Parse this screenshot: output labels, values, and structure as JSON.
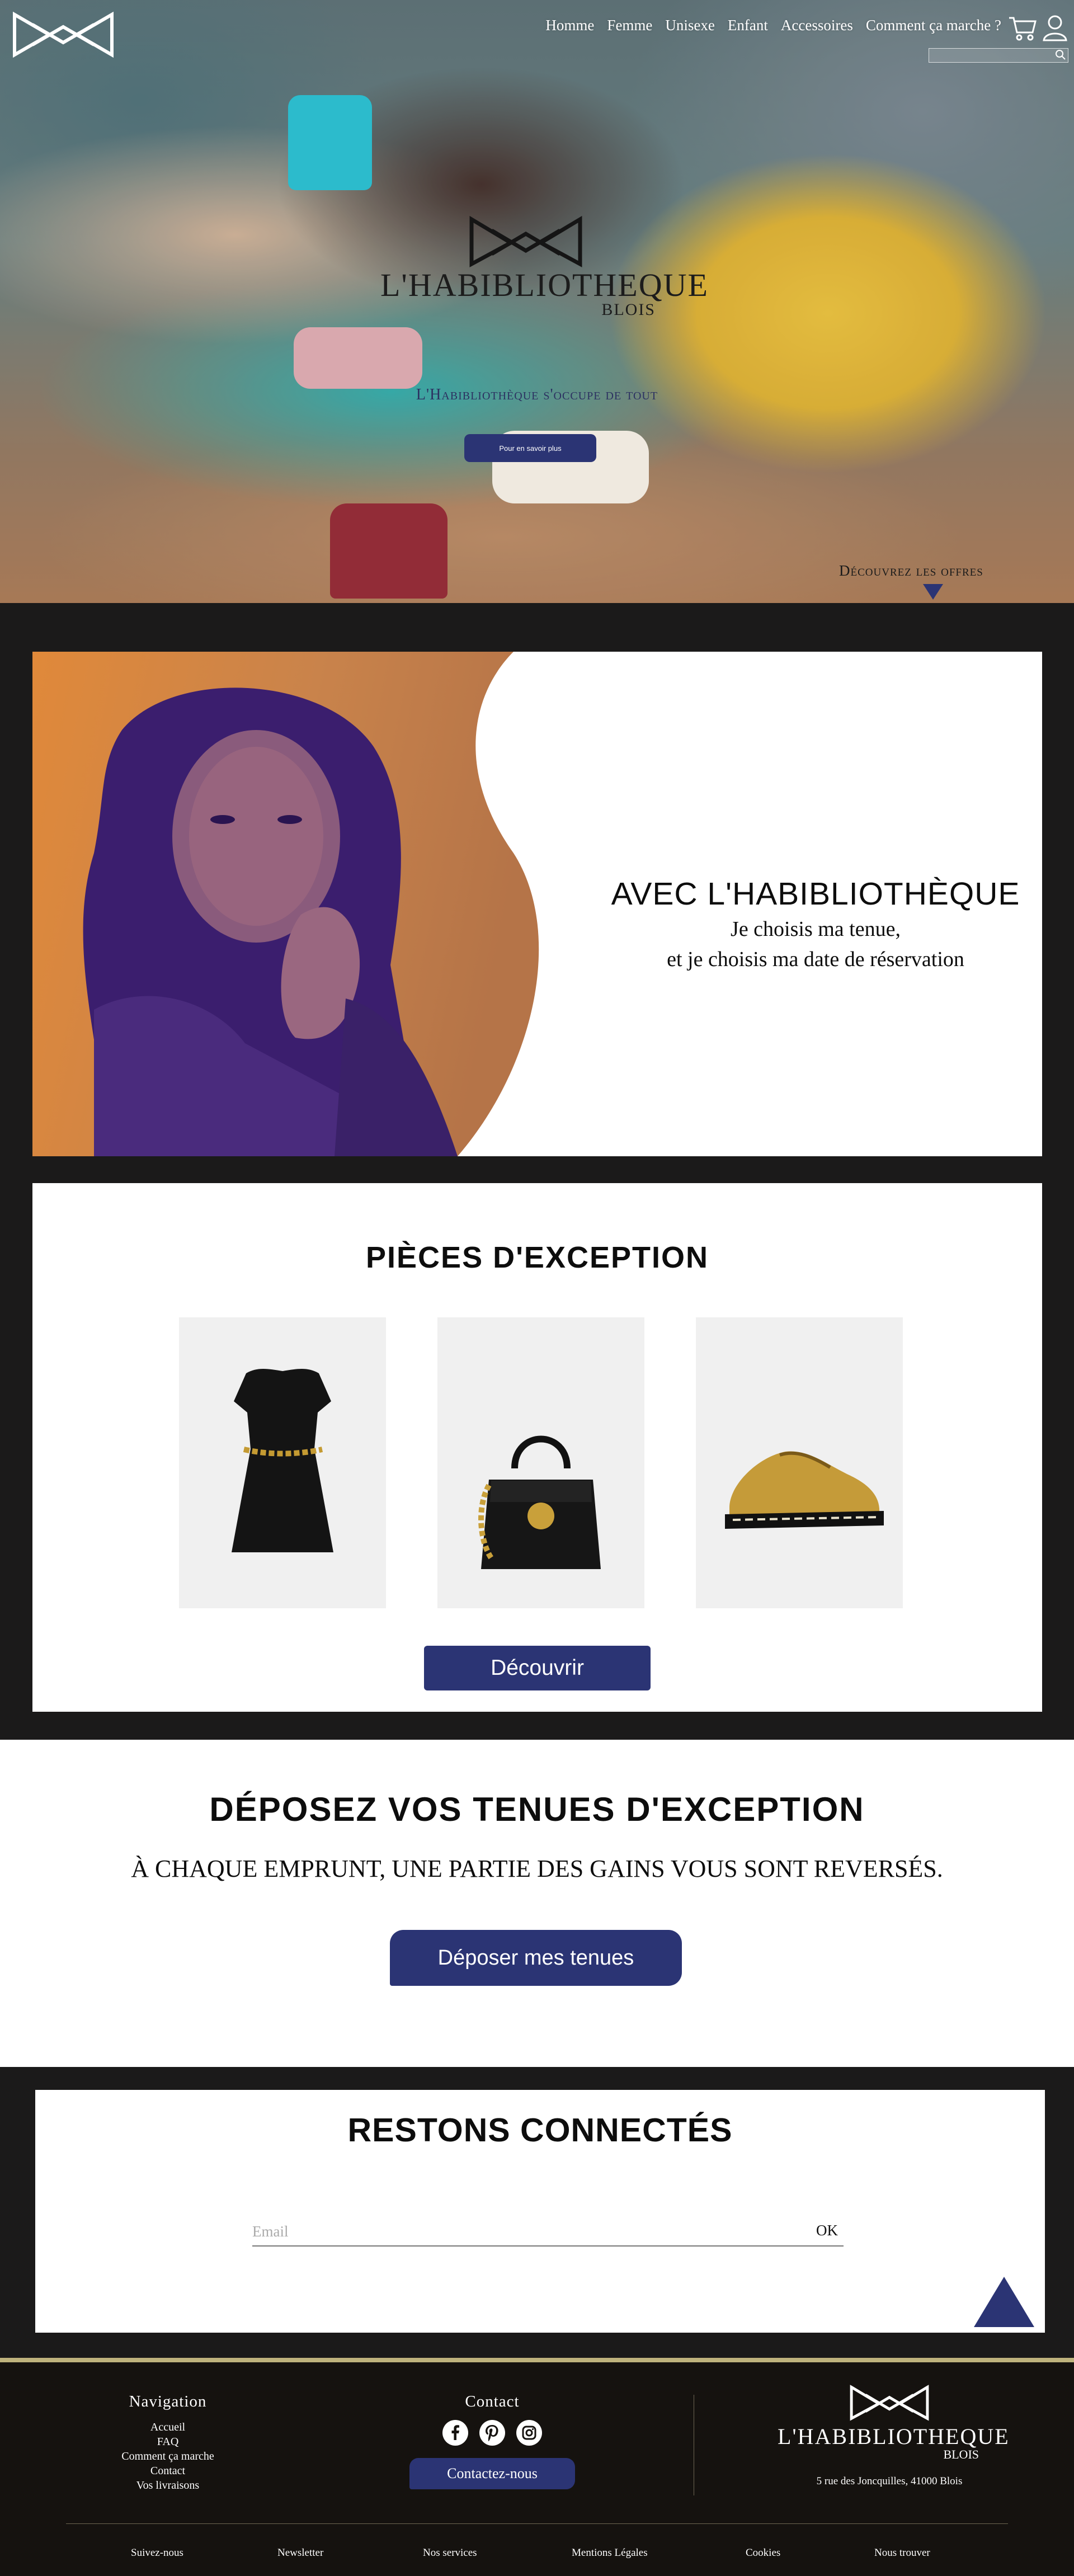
{
  "header": {
    "nav": [
      "Homme",
      "Femme",
      "Unisexe",
      "Enfant",
      "Accessoires",
      "Comment ça marche ?"
    ],
    "search_placeholder": ""
  },
  "hero": {
    "brand_name": "L'HABIBLIOTHEQUE",
    "brand_city": "BLOIS",
    "tagline": "L'Habibliothèque s'occupe de tout",
    "button_label": "Pour en savoir plus",
    "offers_link": "Découvrez les offres"
  },
  "avec": {
    "title": "AVEC L'HABIBLIOTHÈQUE",
    "line1": "Je choisis ma tenue,",
    "line2": "et je choisis ma date de réservation"
  },
  "pieces": {
    "title": "PIÈCES D'EXCEPTION",
    "button_label": "Découvrir"
  },
  "deposez": {
    "title": "DÉPOSEZ VOS TENUES D'EXCEPTION",
    "subtitle": "À CHAQUE EMPRUNT, UNE PARTIE DES GAINS VOUS SONT REVERSÉS.",
    "button_label": "Déposer mes tenues"
  },
  "connect": {
    "title": "RESTONS CONNECTÉS",
    "email_placeholder": "Email",
    "ok_label": "OK"
  },
  "footer": {
    "nav_title": "Navigation",
    "nav_links": [
      "Accueil",
      "FAQ",
      "Comment ça marche",
      "Contact",
      "Vos livraisons"
    ],
    "contact_title": "Contact",
    "contact_button": "Contactez-nous",
    "brand_name": "L'HABIBLIOTHEQUE",
    "brand_city": "BLOIS",
    "address": "5 rue des Joncquilles, 41000 Blois",
    "bottom_links": [
      "Suivez-nous",
      "Newsletter",
      "Nos services",
      "Mentions Légales",
      "Cookies",
      "Nous trouver"
    ]
  },
  "colors": {
    "accent": "#2b3474",
    "dark_background": "#1b1a1a",
    "footer_gold": "#bfb37d"
  },
  "icons": [
    "logo-mark-icon",
    "cart-icon",
    "user-icon",
    "search-icon",
    "facebook-icon",
    "pinterest-icon",
    "instagram-icon",
    "chevron-down-icon",
    "back-to-top-icon"
  ]
}
